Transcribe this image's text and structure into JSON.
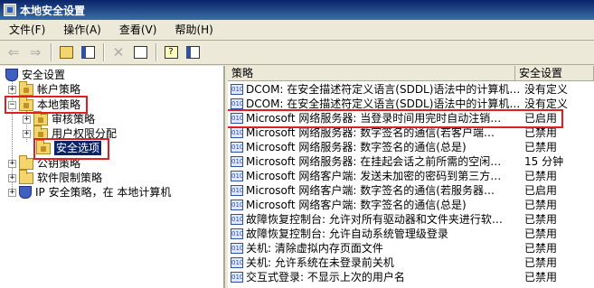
{
  "window": {
    "title": "本地安全设置"
  },
  "menubar": [
    {
      "label": "文件(F)"
    },
    {
      "label": "操作(A)"
    },
    {
      "label": "查看(V)"
    },
    {
      "label": "帮助(H)"
    }
  ],
  "tree": {
    "root": "安全设置",
    "items": [
      {
        "label": "帐户策略"
      },
      {
        "label": "本地策略"
      },
      {
        "label": "审核策略"
      },
      {
        "label": "用户权限分配"
      },
      {
        "label": "安全选项"
      },
      {
        "label": "公钥策略"
      },
      {
        "label": "软件限制策略"
      },
      {
        "label": "IP 安全策略，在 本地计算机"
      }
    ]
  },
  "list": {
    "columns": [
      "策略",
      "安全设置"
    ],
    "rows": [
      {
        "name": "DCOM: 在安全描述符定义语言(SDDL)语法中的计算机…",
        "value": "没有定义"
      },
      {
        "name": "DCOM: 在安全描述符定义语言(SDDL)语法中的计算机…",
        "value": "没有定义"
      },
      {
        "name": "Microsoft 网络服务器: 当登录时间用完时自动注销…",
        "value": "已启用"
      },
      {
        "name": "Microsoft 网络服务器: 数字签名的通信(若客户端…",
        "value": "已禁用"
      },
      {
        "name": "Microsoft 网络服务器: 数字签名的通信(总是)",
        "value": "已禁用"
      },
      {
        "name": "Microsoft 网络服务器: 在挂起会话之前所需的空闲…",
        "value": "15 分钟"
      },
      {
        "name": "Microsoft 网络客户端: 发送未加密的密码到第三方…",
        "value": "已禁用"
      },
      {
        "name": "Microsoft 网络客户端: 数字签名的通信(若服务器…",
        "value": "已启用"
      },
      {
        "name": "Microsoft 网络客户端: 数字签名的通信(总是)",
        "value": "已禁用"
      },
      {
        "name": "故障恢复控制台: 允许对所有驱动器和文件夹进行软…",
        "value": "已禁用"
      },
      {
        "name": "故障恢复控制台: 允许自动系统管理级登录",
        "value": "已禁用"
      },
      {
        "name": "关机: 清除虚拟内存页面文件",
        "value": "已禁用"
      },
      {
        "name": "关机: 允许系统在未登录前关机",
        "value": "已禁用"
      },
      {
        "name": "交互式登录: 不显示上次的用户名",
        "value": "已禁用"
      }
    ]
  },
  "colors": {
    "highlight_box": "#e02020",
    "selection": "#0a246a"
  }
}
